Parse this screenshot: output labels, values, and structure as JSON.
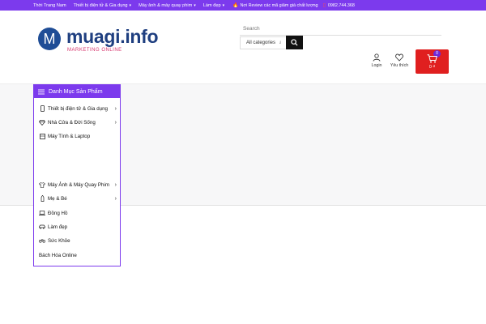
{
  "topbar": {
    "nav": [
      {
        "label": "Thời Trang Nam",
        "has_dropdown": false
      },
      {
        "label": "Thiết bị điện tử & Gia dụng",
        "has_dropdown": true
      },
      {
        "label": "Máy ảnh & máy quay phim",
        "has_dropdown": true
      },
      {
        "label": "Làm đẹp",
        "has_dropdown": true
      }
    ],
    "promo": "Nơi Review các mã giảm giá chất lượng",
    "phone": "0982.744.368",
    "color": "#7c3aed"
  },
  "logo": {
    "letter": "M",
    "name": "muagi.info",
    "tagline": "MARKETING ONLINE"
  },
  "search": {
    "placeholder": "Search",
    "category": "All categories"
  },
  "account": {
    "login": "Login",
    "wishlist": "Yêu thích"
  },
  "cart": {
    "count": "0",
    "total": "0 ₫",
    "color": "#e01f1f"
  },
  "category_menu": {
    "title": "Danh Mục Sản Phẩm",
    "items": [
      {
        "label": "Thiết bị điện tử & Gia dụng",
        "icon": "phone-icon",
        "has_submenu": true
      },
      {
        "label": "Nhà Cửa & Đời Sống",
        "icon": "diamond-icon",
        "has_submenu": true
      },
      {
        "label": "Máy Tính & Laptop",
        "icon": "monitor-icon",
        "has_submenu": false
      },
      {
        "label": "Máy Ảnh & Máy Quay Phim",
        "icon": "shirt-icon",
        "has_submenu": true
      },
      {
        "label": "Mẹ & Bé",
        "icon": "bottle-icon",
        "has_submenu": true
      },
      {
        "label": "Đồng Hồ",
        "icon": "laptop-icon",
        "has_submenu": false
      },
      {
        "label": "Làm đẹp",
        "icon": "car-icon",
        "has_submenu": false
      },
      {
        "label": "Sức Khỏe",
        "icon": "bike-icon",
        "has_submenu": false
      },
      {
        "label": "Bách Hóa Online",
        "icon": "",
        "has_submenu": false
      }
    ]
  }
}
